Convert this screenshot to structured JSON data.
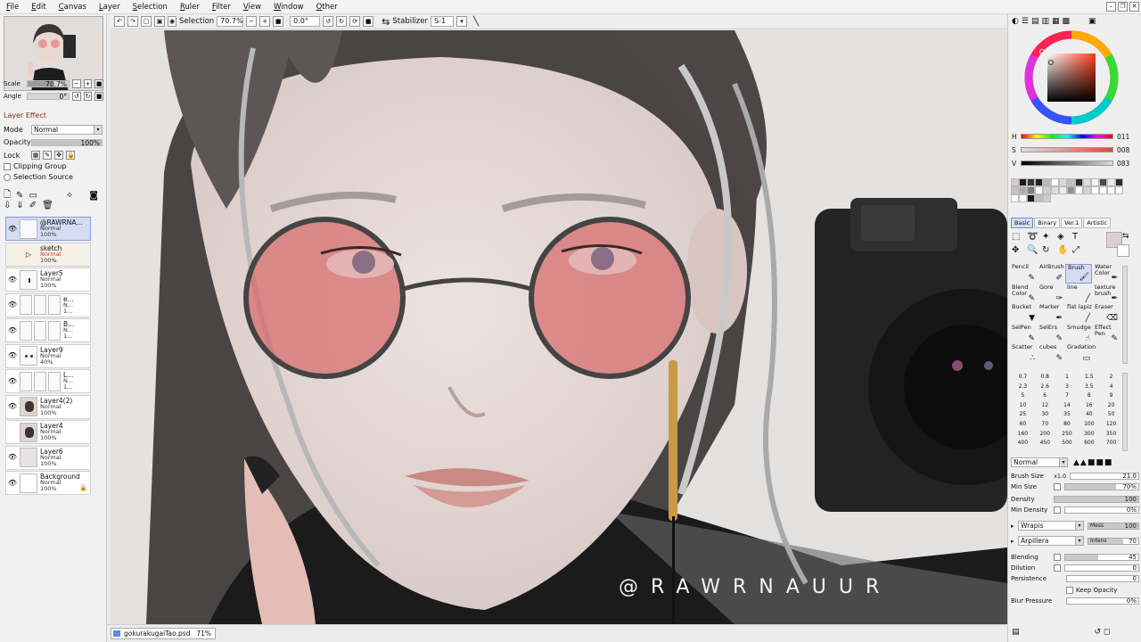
{
  "menu": [
    "File",
    "Edit",
    "Canvas",
    "Layer",
    "Selection",
    "Ruler",
    "Filter",
    "View",
    "Window",
    "Other"
  ],
  "navigator": {
    "scale_label": "Scale",
    "scale_value": "70.7%",
    "angle_label": "Angle",
    "angle_value": "0°"
  },
  "layer_effect": {
    "header": "Layer Effect",
    "mode_label": "Mode",
    "mode_value": "Normal",
    "opacity_label": "Opacity",
    "opacity_value": "100%",
    "opacity_fraction": 1.0,
    "lock_label": "Lock",
    "clipping_group": "Clipping Group",
    "selection_source": "Selection Source"
  },
  "layers": [
    {
      "name": "@RAWRNA...",
      "mode": "Normal",
      "opacity": "100%",
      "selected": true
    },
    {
      "name": "sketch",
      "mode": "Normal",
      "opacity": "100%",
      "selected": false,
      "folder": true
    },
    {
      "name": "Layer5",
      "mode": "Normal",
      "opacity": "100%",
      "selected": false
    },
    {
      "name": "e...",
      "mode": "N...",
      "opacity": "1...",
      "selected": false
    },
    {
      "name": "B...",
      "mode": "N...",
      "opacity": "1...",
      "selected": false
    },
    {
      "name": "Layer9",
      "mode": "Normal",
      "opacity": "40%",
      "selected": false
    },
    {
      "name": "L...",
      "mode": "N...",
      "opacity": "1...",
      "selected": false
    },
    {
      "name": "Layer4(2)",
      "mode": "Normal",
      "opacity": "100%",
      "selected": false
    },
    {
      "name": "Layer4",
      "mode": "Normal",
      "opacity": "100%",
      "selected": false
    },
    {
      "name": "Layer6",
      "mode": "Normal",
      "opacity": "100%",
      "selected": false
    },
    {
      "name": "Background",
      "mode": "Normal",
      "opacity": "100%",
      "selected": false
    }
  ],
  "toolbar": {
    "selection_label": "Selection",
    "zoom_value": "70.7%",
    "angle_value": "0.0°",
    "stabilizer_label": "Stabilizer",
    "stabilizer_value": "S-1"
  },
  "canvas": {
    "watermark": "@RAWRNAUUR"
  },
  "status": {
    "doc_name": "gokurakugaiTao.psd",
    "doc_zoom": "71%"
  },
  "color": {
    "h_label": "H",
    "h_value": "011",
    "s_label": "S",
    "s_value": "008",
    "v_label": "V",
    "v_value": "083",
    "current": "#ddd0cf",
    "swatches": [
      "#d4cbc9",
      "#1b1b1b",
      "#333333",
      "#222222",
      "#b8b8b8",
      "#ffffff",
      "#d9d9d9",
      "#c0c0c0",
      "#2a2a2a",
      "#dedede",
      "#f2f2f2",
      "#4a4a4a",
      "#e8e8e8",
      "#2a2a2a",
      "#c8c4c4",
      "#b3a9a6",
      "#837a79",
      "#ffffff",
      "#d6ccc9",
      "#e4dad7",
      "#f0e8e6",
      "#9a8f8c",
      "#ffffff",
      "#d9d0cf",
      "#ffffff",
      "#ffffff",
      "#ffffff",
      "#ffffff",
      "#ffffff",
      "#ffffff",
      "#1a1a1a",
      "#bfbfbf",
      "#cfcfcf"
    ]
  },
  "tool_tabs": [
    "Basic",
    "Binary",
    "Ver.1",
    "Artistic"
  ],
  "tools": [
    {
      "label": "Pencil",
      "active": false
    },
    {
      "label": "AirBrush",
      "active": false
    },
    {
      "label": "Brush",
      "active": true
    },
    {
      "label": "Water Color",
      "active": false
    },
    {
      "label": "Blend Color",
      "active": false
    },
    {
      "label": "Gore",
      "active": false
    },
    {
      "label": "line",
      "active": false
    },
    {
      "label": "texture brush",
      "active": false
    },
    {
      "label": "Bucket",
      "active": false
    },
    {
      "label": "Marker",
      "active": false
    },
    {
      "label": "flat lapiz",
      "active": false
    },
    {
      "label": "Eraser",
      "active": false
    },
    {
      "label": "SelPen",
      "active": false
    },
    {
      "label": "SelErs",
      "active": false
    },
    {
      "label": "Smudge",
      "active": false
    },
    {
      "label": "Effect Pen",
      "active": false
    },
    {
      "label": "Scatter",
      "active": false
    },
    {
      "label": "cubes",
      "active": false
    },
    {
      "label": "Gradation",
      "active": false
    }
  ],
  "brush_sizes": [
    "0.7",
    "0.8",
    "1",
    "1.5",
    "2",
    "2.3",
    "2.6",
    "3",
    "3.5",
    "4",
    "5",
    "6",
    "7",
    "8",
    "9",
    "10",
    "12",
    "14",
    "16",
    "20",
    "25",
    "30",
    "35",
    "40",
    "50",
    "60",
    "70",
    "80",
    "100",
    "120",
    "160",
    "200",
    "250",
    "300",
    "350",
    "400",
    "450",
    "500",
    "600",
    "700"
  ],
  "brush_props": {
    "blend_mode": "Normal",
    "brush_size_label": "Brush Size",
    "brush_size_mult": "x1.0",
    "brush_size_value": "21.0",
    "min_size_label": "Min Size",
    "min_size_value": "70%",
    "min_size_fraction": 0.7,
    "density_label": "Density",
    "density_value": "100",
    "density_fraction": 1.0,
    "min_density_label": "Min Density",
    "min_density_value": "0%",
    "min_density_fraction": 0.0,
    "shape_value": "Wrapis",
    "shape_level": "Mess",
    "shape_level_value": "100",
    "texture_value": "Arpillera",
    "texture_level": "Intens",
    "texture_level_value": "70",
    "blending_label": "Blending",
    "blending_value": "45",
    "blending_fraction": 0.45,
    "dilution_label": "Dilution",
    "dilution_value": "0",
    "persistence_label": "Persistence",
    "persistence_value": "0",
    "keep_opacity": "Keep Opacity",
    "blur_pressure_label": "Blur Pressure",
    "blur_pressure_value": "0%"
  }
}
